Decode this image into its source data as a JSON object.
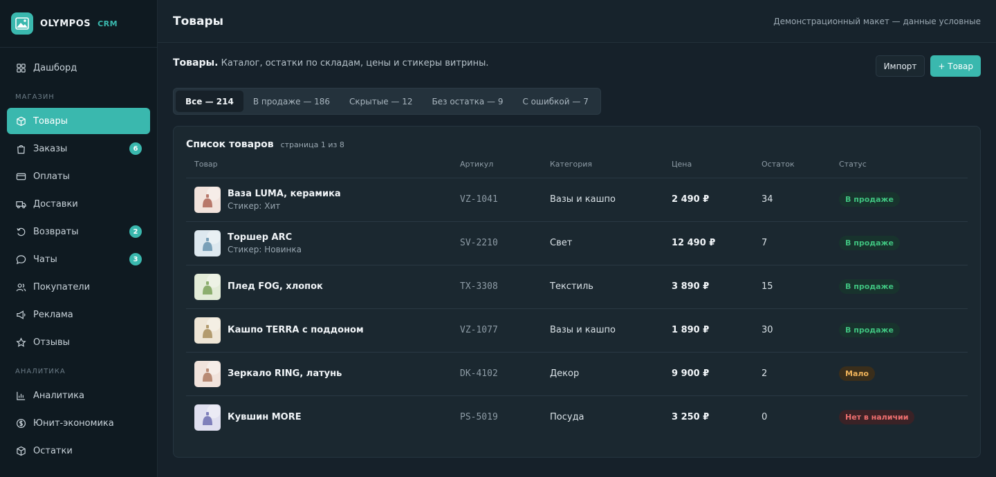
{
  "brand": {
    "name": "OLYMPOS",
    "tag": "CRM"
  },
  "sidebar": {
    "top": [
      {
        "label": "Дашборд",
        "icon": "grid-icon"
      }
    ],
    "section_shop": "МАГАЗИН",
    "shop": [
      {
        "label": "Товары",
        "icon": "box-icon",
        "active": true
      },
      {
        "label": "Заказы",
        "icon": "bag-icon",
        "badge": "6"
      },
      {
        "label": "Оплаты",
        "icon": "card-icon"
      },
      {
        "label": "Доставки",
        "icon": "truck-icon"
      },
      {
        "label": "Возвраты",
        "icon": "return-icon",
        "badge": "2"
      },
      {
        "label": "Чаты",
        "icon": "chat-icon",
        "badge": "3"
      },
      {
        "label": "Покупатели",
        "icon": "users-icon"
      },
      {
        "label": "Реклама",
        "icon": "megaphone-icon"
      },
      {
        "label": "Отзывы",
        "icon": "star-icon"
      }
    ],
    "section_analytics": "АНАЛИТИКА",
    "analytics": [
      {
        "label": "Аналитика",
        "icon": "chart-icon"
      },
      {
        "label": "Юнит-экономика",
        "icon": "coin-icon"
      },
      {
        "label": "Остатки",
        "icon": "stock-icon"
      }
    ]
  },
  "topbar": {
    "title": "Товары",
    "note": "Демонстрационный макет — данные условные"
  },
  "page": {
    "heading_bold": "Товары.",
    "heading_rest": " Каталог, остатки по складам, цены и стикеры витрины.",
    "import_label": "Импорт",
    "add_label": "+ Товар"
  },
  "tabs": [
    {
      "label": "Все — 214",
      "active": true
    },
    {
      "label": "В продаже — 186"
    },
    {
      "label": "Скрытые — 12"
    },
    {
      "label": "Без остатка — 9"
    },
    {
      "label": "С ошибкой — 7"
    }
  ],
  "table": {
    "title": "Список товаров",
    "subtitle": "страница 1 из 8",
    "columns": [
      "Товар",
      "Артикул",
      "Категория",
      "Цена",
      "Остаток",
      "Статус"
    ],
    "rows": [
      {
        "name": "Ваза LUMA, керамика",
        "sticker": "Стикер: Хит",
        "sku": "VZ-1041",
        "category": "Вазы и кашпо",
        "price": "2 490 ₽",
        "stock": "34",
        "status": "В продаже",
        "status_kind": "ok",
        "thumb_bg": "#f2e3dc",
        "thumb_fg": "#b8786a"
      },
      {
        "name": "Торшер ARC",
        "sticker": "Стикер: Новинка",
        "sku": "SV-2210",
        "category": "Свет",
        "price": "12 490 ₽",
        "stock": "7",
        "status": "В продаже",
        "status_kind": "ok",
        "thumb_bg": "#dde8ef",
        "thumb_fg": "#7aa0b8"
      },
      {
        "name": "Плед FOG, хлопок",
        "sticker": "",
        "sku": "TX-3308",
        "category": "Текстиль",
        "price": "3 890 ₽",
        "stock": "15",
        "status": "В продаже",
        "status_kind": "ok",
        "thumb_bg": "#e3ecd8",
        "thumb_fg": "#8cae6e"
      },
      {
        "name": "Кашпо TERRA с поддоном",
        "sticker": "",
        "sku": "VZ-1077",
        "category": "Вазы и кашпо",
        "price": "1 890 ₽",
        "stock": "30",
        "status": "В продаже",
        "status_kind": "ok",
        "thumb_bg": "#efe6d6",
        "thumb_fg": "#b39b6e"
      },
      {
        "name": "Зеркало RING, латунь",
        "sticker": "",
        "sku": "DK-4102",
        "category": "Декор",
        "price": "9 900 ₽",
        "stock": "2",
        "status": "Мало",
        "status_kind": "low",
        "thumb_bg": "#f1e3dc",
        "thumb_fg": "#b88a74"
      },
      {
        "name": "Кувшин MORE",
        "sticker": "",
        "sku": "PS-5019",
        "category": "Посуда",
        "price": "3 250 ₽",
        "stock": "0",
        "status": "Нет в наличии",
        "status_kind": "none",
        "thumb_bg": "#e0e0f0",
        "thumb_fg": "#7f80bb"
      }
    ]
  },
  "colors": {
    "accent": "#3ab8ae",
    "sidebar_bg": "#0f1a21",
    "main_bg": "#16212a",
    "card_bg": "#1b2830"
  }
}
